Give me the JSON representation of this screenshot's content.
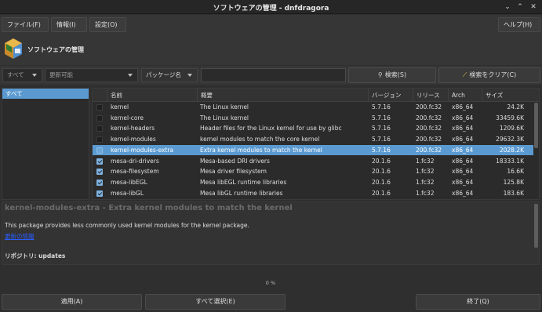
{
  "window": {
    "title": "ソフトウェアの管理 - dnfdragora",
    "minimize": "⌄",
    "maximize": "⌃",
    "close": "✕"
  },
  "menubar": {
    "file": "ファイル(F)",
    "info": "情報(I)",
    "settings": "設定(O)",
    "help": "ヘルプ(H)"
  },
  "header": {
    "title": "ソフトウェアの管理"
  },
  "filters": {
    "view": "すべて",
    "status": "更新可能",
    "search_by": "パッケージ名",
    "search_value": "",
    "search_button": "検索(S)",
    "clear_button": "検索をクリア(C)"
  },
  "groups": {
    "items": [
      {
        "label": "すべて",
        "selected": true
      }
    ]
  },
  "table": {
    "columns": [
      "名前",
      "概要",
      "バージョン",
      "リリース",
      "Arch",
      "サイズ"
    ],
    "rows": [
      {
        "checked": false,
        "selected": false,
        "name": "kernel",
        "summary": "The Linux kernel",
        "version": "5.7.16",
        "release": "200.fc32",
        "arch": "x86_64",
        "size": "24.2K"
      },
      {
        "checked": false,
        "selected": false,
        "name": "kernel-core",
        "summary": "The Linux kernel",
        "version": "5.7.16",
        "release": "200.fc32",
        "arch": "x86_64",
        "size": "33459.6K"
      },
      {
        "checked": false,
        "selected": false,
        "name": "kernel-headers",
        "summary": "Header files for the Linux kernel for use by glibc",
        "version": "5.7.16",
        "release": "200.fc32",
        "arch": "x86_64",
        "size": "1209.6K"
      },
      {
        "checked": false,
        "selected": false,
        "name": "kernel-modules",
        "summary": "kernel modules to match the core kernel",
        "version": "5.7.16",
        "release": "200.fc32",
        "arch": "x86_64",
        "size": "29632.3K"
      },
      {
        "checked": false,
        "selected": true,
        "name": "kernel-modules-extra",
        "summary": "Extra kernel modules to match the kernel",
        "version": "5.7.16",
        "release": "200.fc32",
        "arch": "x86_64",
        "size": "2028.2K"
      },
      {
        "checked": true,
        "selected": false,
        "name": "mesa-dri-drivers",
        "summary": "Mesa-based DRI drivers",
        "version": "20.1.6",
        "release": "1.fc32",
        "arch": "x86_64",
        "size": "18333.1K"
      },
      {
        "checked": true,
        "selected": false,
        "name": "mesa-filesystem",
        "summary": "Mesa driver filesystem",
        "version": "20.1.6",
        "release": "1.fc32",
        "arch": "x86_64",
        "size": "16.6K"
      },
      {
        "checked": true,
        "selected": false,
        "name": "mesa-libEGL",
        "summary": "Mesa libEGL runtime libraries",
        "version": "20.1.6",
        "release": "1.fc32",
        "arch": "x86_64",
        "size": "125.8K"
      },
      {
        "checked": true,
        "selected": false,
        "name": "mesa-libGL",
        "summary": "Mesa libGL runtime libraries",
        "version": "20.1.6",
        "release": "1.fc32",
        "arch": "x86_64",
        "size": "183.6K"
      }
    ]
  },
  "info": {
    "title": "kernel-modules-extra - Extra kernel modules to match the kernel",
    "description": "This package provides less commonly used kernel modules for the kernel package.",
    "link": "更新の情報",
    "repository": "リポジトリ: updates"
  },
  "progress": {
    "label": "0 %",
    "value": 0
  },
  "footer": {
    "apply": "適用(A)",
    "select_all": "すべて選択(E)",
    "quit": "終了(Q)"
  },
  "colors": {
    "selection": "#5b9ad0",
    "background": "#2f2f2f",
    "link": "#2a5cff"
  }
}
